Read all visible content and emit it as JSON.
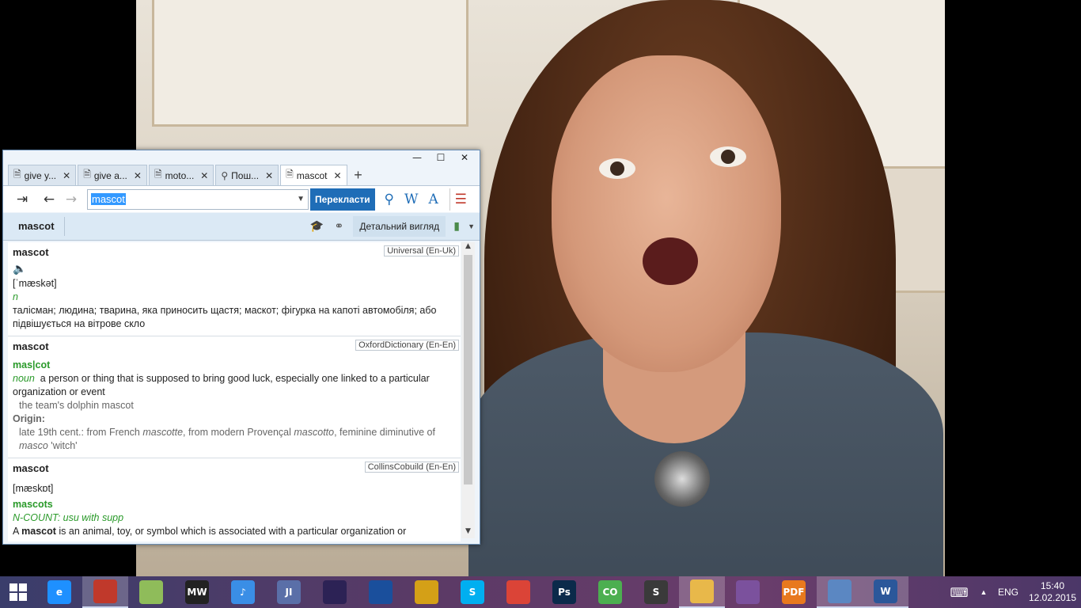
{
  "window": {
    "controls": {
      "minimize": "—",
      "maximize": "☐",
      "close": "✕"
    },
    "tabs": [
      {
        "icon": "page-icon",
        "label": "give y...",
        "active": false
      },
      {
        "icon": "page-icon",
        "label": "give a...",
        "active": false
      },
      {
        "icon": "page-icon",
        "label": "moto...",
        "active": false
      },
      {
        "icon": "search-icon",
        "label": "Пош...",
        "active": false
      },
      {
        "icon": "page-icon",
        "label": "mascot",
        "active": true
      }
    ],
    "tab_add": "+"
  },
  "toolbar": {
    "search_value": "mascot",
    "translate_label": "Перекласти",
    "icons": [
      "pin-icon",
      "back-arrow-icon",
      "forward-arrow-icon",
      "search-icon",
      "wikipedia-icon",
      "font-icon",
      "lingvo-icon"
    ]
  },
  "header": {
    "headword": "mascot",
    "detail_view_label": "Детальний вигляд"
  },
  "entries": [
    {
      "head": "mascot",
      "dictionary": "Universal (En-Uk)",
      "transcription": "[ˈmæskət]",
      "pos": "n",
      "definition": "талісман; людина; тварина, яка приносить щастя; маскот; фігурка на капоті автомобіля; або підвішується на вітрове скло"
    },
    {
      "head": "mascot",
      "dictionary": "OxfordDictionary (En-En)",
      "syllables": "mas|cot",
      "pos": "noun",
      "definition": "a person or thing that is supposed to bring good luck, especially one linked to a particular organization or event",
      "example": "the team's dolphin mascot",
      "origin_label": "Origin:",
      "origin_text_1": "late 19th cent.: from French ",
      "origin_word_1": "mascotte",
      "origin_text_2": ", from modern Provençal ",
      "origin_word_2": "mascotto",
      "origin_text_3": ", feminine diminutive of",
      "origin_word_3": "masco",
      "origin_text_4": " 'witch'"
    },
    {
      "head": "mascot",
      "dictionary": "CollinsCobuild (En-En)",
      "transcription": "[mæskɒt]",
      "plural": "mascots",
      "grammar": "N-COUNT: usu with supp",
      "definition_start": "A ",
      "definition_bold": "mascot",
      "definition_rest": " is an animal, toy, or symbol which is associated with a particular organization or"
    }
  ],
  "taskbar": {
    "apps": [
      {
        "name": "internet-explorer-icon",
        "label": "e",
        "color": "#1e90ff"
      },
      {
        "name": "lingvo-taskbar-icon",
        "label": "",
        "color": "#c0392b",
        "active": true
      },
      {
        "name": "notepad-green-icon",
        "label": "",
        "color": "#8fbc5a"
      },
      {
        "name": "nfs-game-icon",
        "label": "MW",
        "color": "#222222"
      },
      {
        "name": "itunes-icon",
        "label": "♪",
        "color": "#3a8ee6"
      },
      {
        "name": "ji-app-icon",
        "label": "JI",
        "color": "#5a6fa8"
      },
      {
        "name": "eclipse-icon",
        "label": "",
        "color": "#2c2255"
      },
      {
        "name": "globe-icon",
        "label": "",
        "color": "#1a4f9c"
      },
      {
        "name": "tools-icon",
        "label": "",
        "color": "#d4a017"
      },
      {
        "name": "skype-icon",
        "label": "S",
        "color": "#00aff0"
      },
      {
        "name": "chrome-icon",
        "label": "",
        "color": "#db4437"
      },
      {
        "name": "photoshop-icon",
        "label": "Ps",
        "color": "#0b2a4a"
      },
      {
        "name": "coo-app-icon",
        "label": "CO",
        "color": "#4caf50"
      },
      {
        "name": "sublime-icon",
        "label": "S",
        "color": "#3a3a3a"
      },
      {
        "name": "file-explorer-icon",
        "label": "",
        "color": "#e8b84a",
        "active": true
      },
      {
        "name": "viber-icon",
        "label": "",
        "color": "#7b519d"
      },
      {
        "name": "pdf-icon",
        "label": "PDF",
        "color": "#e8791e"
      },
      {
        "name": "disk-app-icon",
        "label": "",
        "color": "#5b87c2",
        "active": true
      },
      {
        "name": "word-icon",
        "label": "W",
        "color": "#2b579a",
        "active": true
      }
    ],
    "language": "ENG",
    "time": "15:40",
    "date": "12.02.2015"
  }
}
